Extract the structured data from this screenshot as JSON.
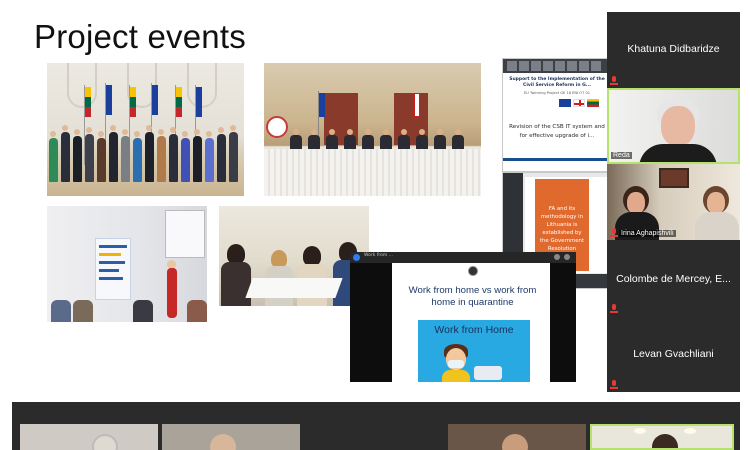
{
  "slide": {
    "title": "Project events"
  },
  "presentations": {
    "slide1": {
      "title": "Support to the Implementation of the Civil Service Reform in G...",
      "subtitle": "EU Twinning Project GE 18 ENI OT 01",
      "body": "Revision of the CSB IT system and for effective upgrade of i..."
    },
    "slide2": {
      "body": "FA and its methodology in Lithuania is established by the Government Resolution"
    },
    "slide3": {
      "header_title": "Work from ...",
      "header_sub": "...",
      "title": "Work from home vs work from home in quarantine",
      "box_text": "Work from Home"
    }
  },
  "participants": [
    {
      "name": "Khatuna Didbaridze",
      "muted": true
    },
    {
      "name": "Reda",
      "muted": false
    },
    {
      "name": "Irina Aghapishvili",
      "muted": true
    },
    {
      "name": "Colombe de Mercey, E...",
      "muted": true
    },
    {
      "name": "Levan Gvachliani",
      "muted": true
    }
  ],
  "colors": {
    "active_speaker_border": "#b5e26a",
    "tile_bg": "#2b2b2b",
    "mute_red": "#e53935"
  }
}
